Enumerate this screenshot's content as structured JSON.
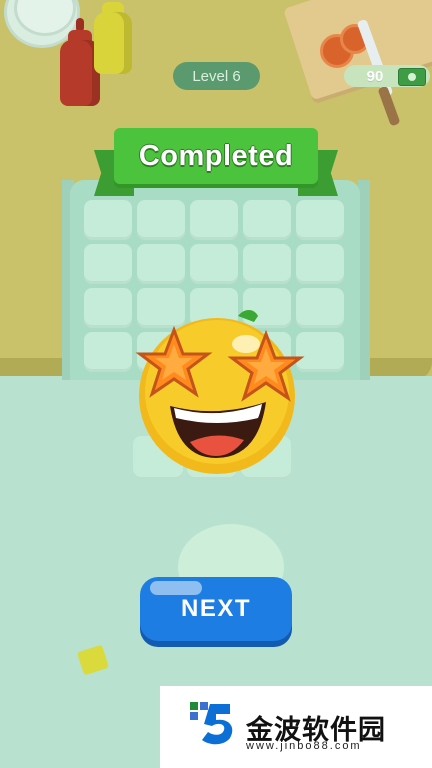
{
  "game": {
    "level_label": "Level 6",
    "coins": "90",
    "banner_title": "Completed",
    "next_button_label": "NEXT"
  },
  "icons": {
    "cash": "cash-icon",
    "emoji": "star-eyes-emoji-icon"
  },
  "watermark": {
    "brand": "金波软件园",
    "url": "www.jinbo88.com"
  },
  "colors": {
    "counter": "#c9c26a",
    "floor": "#b8e2cf",
    "banner_green": "#4cc33c",
    "next_blue": "#1e7de3"
  }
}
